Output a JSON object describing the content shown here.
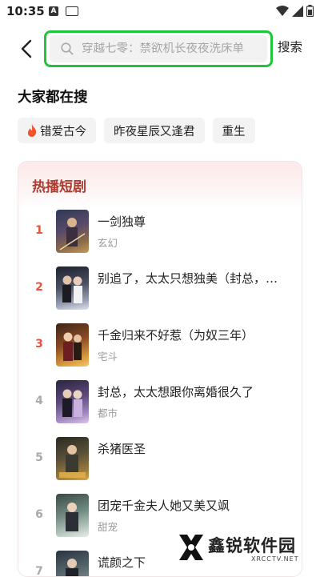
{
  "status_bar": {
    "time": "10:35",
    "notification_letter": "A"
  },
  "header": {
    "search_placeholder": "穿越七零：禁欲机长夜夜洗床单",
    "search_button": "搜索"
  },
  "trending": {
    "title": "大家都在搜",
    "tags": [
      "错爱古今",
      "昨夜星辰又逢君",
      "重生"
    ]
  },
  "hot_drama": {
    "title": "热播短剧",
    "items": [
      {
        "rank": "1",
        "name": "一剑独尊",
        "genre": "玄幻"
      },
      {
        "rank": "2",
        "name": "别追了，太太只想独美（封总，…",
        "genre": ""
      },
      {
        "rank": "3",
        "name": "千金归来不好惹（为奴三年）",
        "genre": "宅斗"
      },
      {
        "rank": "4",
        "name": "封总，太太想跟你离婚很久了",
        "genre": "都市"
      },
      {
        "rank": "5",
        "name": "杀猪医圣",
        "genre": ""
      },
      {
        "rank": "6",
        "name": "团宠千金夫人她又美又飒",
        "genre": "甜宠"
      },
      {
        "rank": "7",
        "name": "谎颜之下",
        "genre": ""
      }
    ]
  },
  "watermark": {
    "text": "鑫锐软件园",
    "sub": "XRCCTV.NET"
  },
  "colors": {
    "accent_green": "#1fc53b",
    "rank_top": "#e5533d",
    "card_title": "#b03a2e"
  }
}
